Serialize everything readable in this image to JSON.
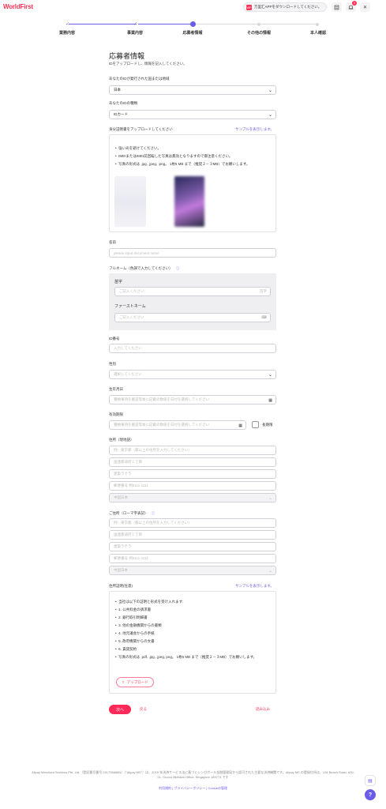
{
  "header": {
    "logo": "WorldFirst",
    "app_badge": "WF",
    "app_text": "万里汇APPをダウンロードしてください。",
    "notification_count": "1"
  },
  "stepper": {
    "steps": [
      "業務内容",
      "事業内容",
      "応募者情報",
      "その他の情報",
      "本人確認"
    ],
    "current_index": 2
  },
  "form": {
    "title": "応募者情報",
    "subtitle": "IDをアップロードし、情報を記入してください。",
    "issuing_country": {
      "label": "あなたのIDが発行された国または地域",
      "value": "日本"
    },
    "id_type": {
      "label": "あなたのIDの種類",
      "value": "IDカード"
    },
    "id_upload": {
      "label": "身分証明書をアップロードしてください",
      "sample_link": "サンプルを表示します。",
      "bullets": [
        "強い光を避けてください。",
        "IMEIまたはIMEI前回転した写真は無効となりますので御注意ください。",
        "写真の形式は .jpg, .jpeg, .png。 1枚5 MB まで（推奨２－３MB）でお願いします。"
      ]
    },
    "name": {
      "label": "名前",
      "placeholder": "please input document name"
    },
    "fullname": {
      "label": "フルネーム（色調で入力してください）",
      "surname_label": "苗字",
      "surname_placeholder": "ご記入ください",
      "surname_suffix": "苗字",
      "firstname_label": "ファーストネーム",
      "firstname_placeholder": "ご記入ください"
    },
    "id_number": {
      "label": "ID番号",
      "placeholder": "入力してください"
    },
    "gender": {
      "label": "性別",
      "placeholder": "選択してください"
    },
    "birthdate": {
      "label": "生年月日",
      "placeholder": "種類事項を確認等後に記載の数値を日付を選択してください"
    },
    "expiry": {
      "label": "有効期限",
      "placeholder": "種類事項を確認等後に記載の数値を日付を選択してください",
      "checkbox_label": "長期限"
    },
    "address_local": {
      "label": "住所（現地語）",
      "fields": [
        "例：東京都（都以上の住所を入力してください）",
        "国連都道府１丁目",
        "建築ラテラ",
        "郵便番号 例0111-1111"
      ],
      "country": "中国日本"
    },
    "address_roman": {
      "label": "ご住所（ローマ字表記）",
      "fields": [
        "例：東京都（都以上の住所を入力してください）",
        "国連都道府１丁目",
        "建築ラテラ",
        "郵便番号 例0111-1111"
      ],
      "country": "中国日本"
    },
    "address_proof": {
      "label": "住所証明(任意)",
      "sample_link": "サンプルを表示します。",
      "intro": "当社は以下の証明と形式を受け入れます:",
      "bullets": [
        "1. 公共料金の請求書",
        "2. 銀行取引明細書",
        "3. 他の金融機関からの書類",
        "4. 地元議会からの手紙",
        "5. 政府機関からの文書",
        "6. 賃貸契約",
        "写真の形式は .pdf, .jpg, .jpeg, png。 1枚5 MB まで（推奨２－３MB）でお願いします。"
      ],
      "upload_label": "アップロード"
    },
    "buttons": {
      "next": "次へ",
      "back": "戻る",
      "save": "読み込み"
    }
  },
  "footer": {
    "line1": "Alipay Merchant Services Pte. Ltd.（登記番号番号 201735686N）（\"Alipay MS\"）は、2019 年決済サービス法に基づくシンガポール金融管理局から認可された主要な決済機関です。Alipay MS の登録住所は、128 Beach Road, #20-01, Guoco Midtown Office, Singapore 189773 です",
    "line2": "利用規約 | プライバシーポリシー | Cookieの管理"
  },
  "colors": {
    "brand": "#ff3155",
    "accent": "#6b5ce7",
    "stepper_done": "#6b5ce7"
  }
}
